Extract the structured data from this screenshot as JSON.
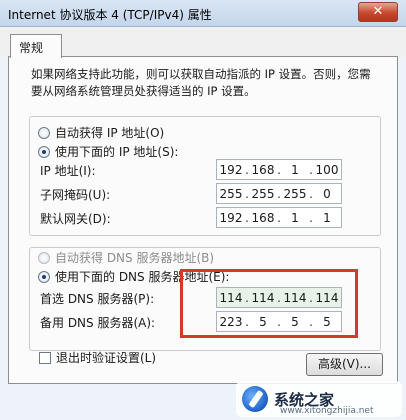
{
  "window": {
    "title": "Internet 协议版本 4 (TCP/IPv4) 属性",
    "close_label": "✕"
  },
  "tabs": [
    {
      "label": "常规"
    }
  ],
  "intro_text": "如果网络支持此功能，则可以获取自动指派的 IP 设置。否则，您需要从网络系统管理员处获得适当的 IP 设置。",
  "ip_group": {
    "auto_radio": "自动获得 IP 地址(O)",
    "manual_radio": "使用下面的 IP 地址(S):",
    "selected": "manual",
    "fields": [
      {
        "label": "IP 地址(I):",
        "octets": [
          "192",
          "168",
          "1",
          "100"
        ]
      },
      {
        "label": "子网掩码(U):",
        "octets": [
          "255",
          "255",
          "255",
          "0"
        ]
      },
      {
        "label": "默认网关(D):",
        "octets": [
          "192",
          "168",
          "1",
          "1"
        ]
      }
    ]
  },
  "dns_group": {
    "auto_radio": "自动获得 DNS 服务器地址(B)",
    "manual_radio": "使用下面的 DNS 服务器地址(E):",
    "selected": "manual",
    "fields": [
      {
        "label": "首选 DNS 服务器(P):",
        "octets": [
          "114",
          "114",
          "114",
          "114"
        ]
      },
      {
        "label": "备用 DNS 服务器(A):",
        "octets": [
          "223",
          "5",
          "5",
          "5"
        ]
      }
    ]
  },
  "validate_checkbox": {
    "label": "退出时验证设置(L)",
    "checked": false
  },
  "advanced_button": "高级(V)...",
  "watermark": {
    "text": "系统之家",
    "url": "www.xitongzhijia.net"
  },
  "colors": {
    "highlight": "#d23a2f",
    "filled_field": "#e6f3e6"
  }
}
